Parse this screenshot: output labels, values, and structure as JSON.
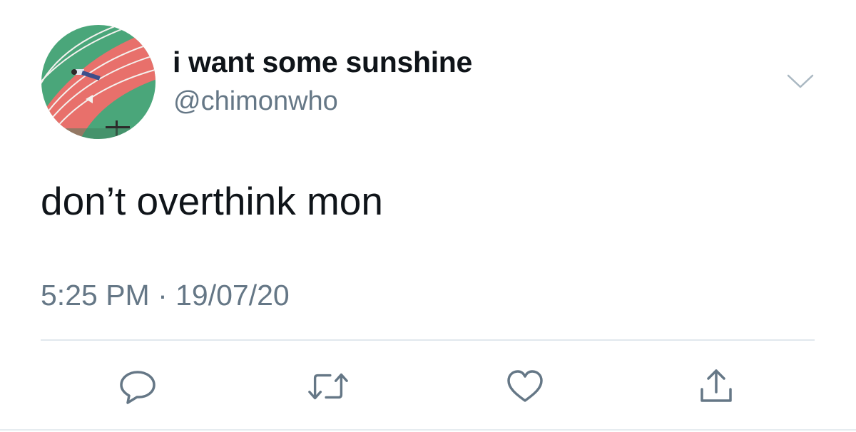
{
  "user": {
    "display_name": "i want some sunshine",
    "handle": "@chimonwho",
    "avatar_icon": "avatar-image"
  },
  "tweet": {
    "text": "don’t overthink mon",
    "timestamp": "5:25 PM · 19/07/20"
  },
  "actions": {
    "reply_icon": "reply-icon",
    "retweet_icon": "retweet-icon",
    "like_icon": "heart-icon",
    "share_icon": "share-icon"
  },
  "colors": {
    "text_primary": "#0f1419",
    "text_secondary": "#657786",
    "divider": "#e1e8ed",
    "icon": "#657786",
    "avatar_track": "#e8706b",
    "avatar_field": "#4aa67a"
  }
}
